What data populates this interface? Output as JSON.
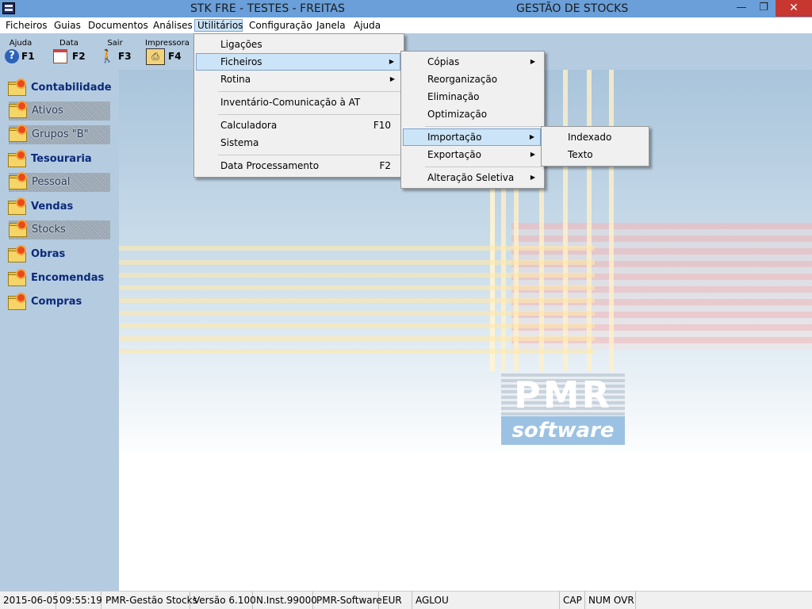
{
  "window": {
    "title_left": "STK FRE - TESTES - FREITAS",
    "title_right": "GESTÃO DE STOCKS",
    "min_glyph": "—",
    "restore_glyph": "❐",
    "close_glyph": "✕"
  },
  "menubar": {
    "items": [
      "Ficheiros",
      "Guias",
      "Documentos",
      "Análises",
      "Utilitários",
      "Configuração",
      "Janela",
      "Ajuda"
    ]
  },
  "toolbar": {
    "buttons": [
      {
        "label": "Ajuda",
        "key": "F1",
        "icon": "help-icon"
      },
      {
        "label": "Data",
        "key": "F2",
        "icon": "calendar-icon"
      },
      {
        "label": "Sair",
        "key": "F3",
        "icon": "exit-icon"
      },
      {
        "label": "Impressora",
        "key": "F4",
        "icon": "printer-icon"
      }
    ]
  },
  "sidebar": {
    "items": [
      {
        "label": "Contabilidade",
        "enabled": true
      },
      {
        "label": "Ativos",
        "enabled": false
      },
      {
        "label": "Grupos \"B\"",
        "enabled": false
      },
      {
        "label": "Tesouraria",
        "enabled": true
      },
      {
        "label": "Pessoal",
        "enabled": false
      },
      {
        "label": "Vendas",
        "enabled": true
      },
      {
        "label": "Stocks",
        "enabled": false
      },
      {
        "label": "Obras",
        "enabled": true
      },
      {
        "label": "Encomendas",
        "enabled": true
      },
      {
        "label": "Compras",
        "enabled": true
      }
    ]
  },
  "utilitarios_menu": {
    "items": [
      {
        "label": "Ligações",
        "shortcut": ""
      },
      {
        "label": "Ficheiros",
        "shortcut": ""
      },
      {
        "label": "Rotina",
        "shortcut": ""
      },
      {
        "label": "Inventário-Comunicação à AT",
        "shortcut": ""
      },
      {
        "label": "Calculadora",
        "shortcut": "F10"
      },
      {
        "label": "Sistema",
        "shortcut": ""
      },
      {
        "label": "Data Processamento",
        "shortcut": "F2"
      }
    ]
  },
  "ficheiros_menu": {
    "items": [
      {
        "label": "Cópias"
      },
      {
        "label": "Reorganização"
      },
      {
        "label": "Eliminação"
      },
      {
        "label": "Optimização"
      },
      {
        "label": "Importação"
      },
      {
        "label": "Exportação"
      },
      {
        "label": "Alteração Seletiva"
      }
    ]
  },
  "importacao_menu": {
    "items": [
      {
        "label": "Indexado"
      },
      {
        "label": "Texto"
      }
    ]
  },
  "background_logo": {
    "line1": "PMR",
    "line2": "software"
  },
  "statusbar": {
    "date": "2015-06-05",
    "time": "09:55:19",
    "app": "PMR-Gestão Stocks",
    "version": "Versão  6.100",
    "installation": "N.Inst.99000",
    "vendor": "PMR-Software",
    "currency": "EUR",
    "user": "AGLOU",
    "caps": "CAP",
    "num_ovr": "NUM OVR"
  },
  "colors": {
    "titlebar": "#6a9fd9",
    "panel": "#b5cbe0",
    "highlight": "#cce4f7",
    "close_button": "#c7372f"
  }
}
